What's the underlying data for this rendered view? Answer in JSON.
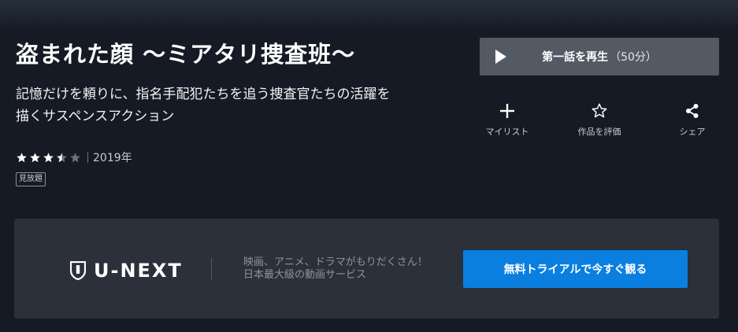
{
  "title": "盗まれた顔 〜ミアタリ捜査班〜",
  "description": "記憶だけを頼りに、指名手配犯たちを追う捜査官たちの活躍を描くサスペンスアクション",
  "rating": {
    "value": 3.5,
    "max": 5
  },
  "year": "2019年",
  "badge": "見放題",
  "play_button": {
    "label": "第一話を再生",
    "duration": "（50分）"
  },
  "actions": [
    {
      "label": "マイリスト",
      "icon": "plus-icon"
    },
    {
      "label": "作品を評価",
      "icon": "star-outline-icon"
    },
    {
      "label": "シェア",
      "icon": "share-icon"
    }
  ],
  "promo": {
    "logo_text": "U-NEXT",
    "line1": "映画、アニメ、ドラマがもりだくさん！",
    "line2": "日本最大級の動画サービス",
    "cta": "無料トライアルで今すぐ観る"
  },
  "colors": {
    "background": "#151a24",
    "play_button": "#545a64",
    "promo_panel": "#2b303b",
    "cta": "#0a7fdf",
    "star_filled": "#ffffff",
    "star_empty": "#6b717c"
  }
}
